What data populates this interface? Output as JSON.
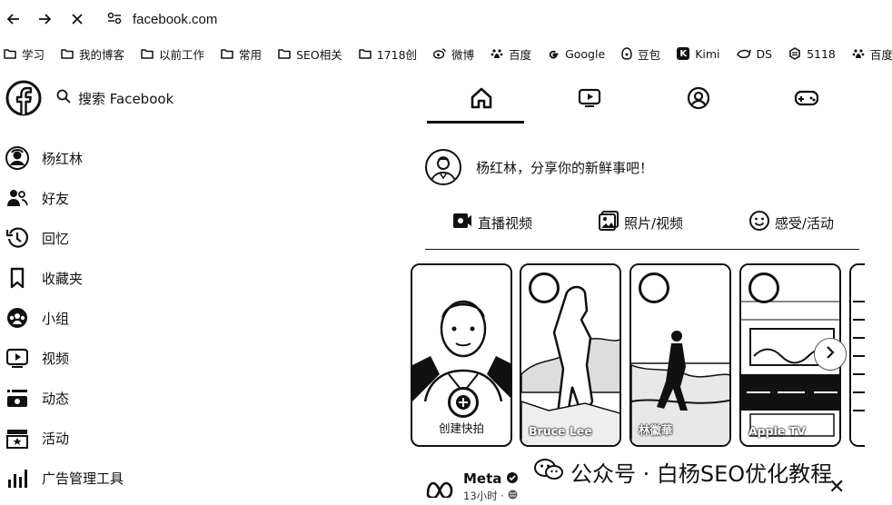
{
  "browser": {
    "url": "facebook.com",
    "back_icon": "arrow-left",
    "forward_icon": "arrow-right",
    "reload_icon": "close-x"
  },
  "bookmarks": [
    {
      "label": "学习",
      "icon": "folder"
    },
    {
      "label": "我的博客",
      "icon": "folder"
    },
    {
      "label": "以前工作",
      "icon": "folder"
    },
    {
      "label": "常用",
      "icon": "folder"
    },
    {
      "label": "SEO相关",
      "icon": "folder"
    },
    {
      "label": "1718创",
      "icon": "folder"
    },
    {
      "label": "微博",
      "icon": "weibo"
    },
    {
      "label": "百度",
      "icon": "baidu-paw"
    },
    {
      "label": "Google",
      "icon": "google-g"
    },
    {
      "label": "豆包",
      "icon": "doubao"
    },
    {
      "label": "Kimi",
      "icon": "kimi-k"
    },
    {
      "label": "DS",
      "icon": "deepseek-whale"
    },
    {
      "label": "5118",
      "icon": "5118"
    },
    {
      "label": "百度",
      "icon": "baidu-paw"
    }
  ],
  "sidebar": {
    "search_placeholder": "搜索 Facebook",
    "items": [
      {
        "label": "杨红林",
        "icon": "avatar"
      },
      {
        "label": "好友",
        "icon": "friends-icon"
      },
      {
        "label": "回忆",
        "icon": "memories-clock-icon"
      },
      {
        "label": "收藏夹",
        "icon": "bookmark-icon"
      },
      {
        "label": "小组",
        "icon": "groups-icon"
      },
      {
        "label": "视频",
        "icon": "video-icon"
      },
      {
        "label": "动态",
        "icon": "feeds-icon"
      },
      {
        "label": "活动",
        "icon": "events-icon"
      },
      {
        "label": "广告管理工具",
        "icon": "ads-chart-icon"
      }
    ]
  },
  "tabs": [
    {
      "name": "home",
      "icon": "home-icon",
      "active": true
    },
    {
      "name": "video",
      "icon": "video-tv-icon",
      "active": false
    },
    {
      "name": "profile",
      "icon": "profile-icon",
      "active": false
    },
    {
      "name": "gaming",
      "icon": "gamepad-icon",
      "active": false
    }
  ],
  "composer": {
    "prompt": "杨红林，分享你的新鲜事吧！",
    "actions": [
      {
        "label": "直播视频",
        "icon": "live-video-icon"
      },
      {
        "label": "照片/视频",
        "icon": "photo-icon"
      },
      {
        "label": "感受/活动",
        "icon": "smile-icon"
      }
    ]
  },
  "stories": {
    "create_label": "创建快拍",
    "items": [
      {
        "label": "Bruce Lee"
      },
      {
        "label": "林徽華"
      },
      {
        "label": "Apple TV"
      },
      {
        "label": ""
      }
    ]
  },
  "post": {
    "author": "Meta",
    "time": "13小时 ·"
  },
  "watermark": {
    "text": "公众号 · 白杨SEO优化教程"
  }
}
